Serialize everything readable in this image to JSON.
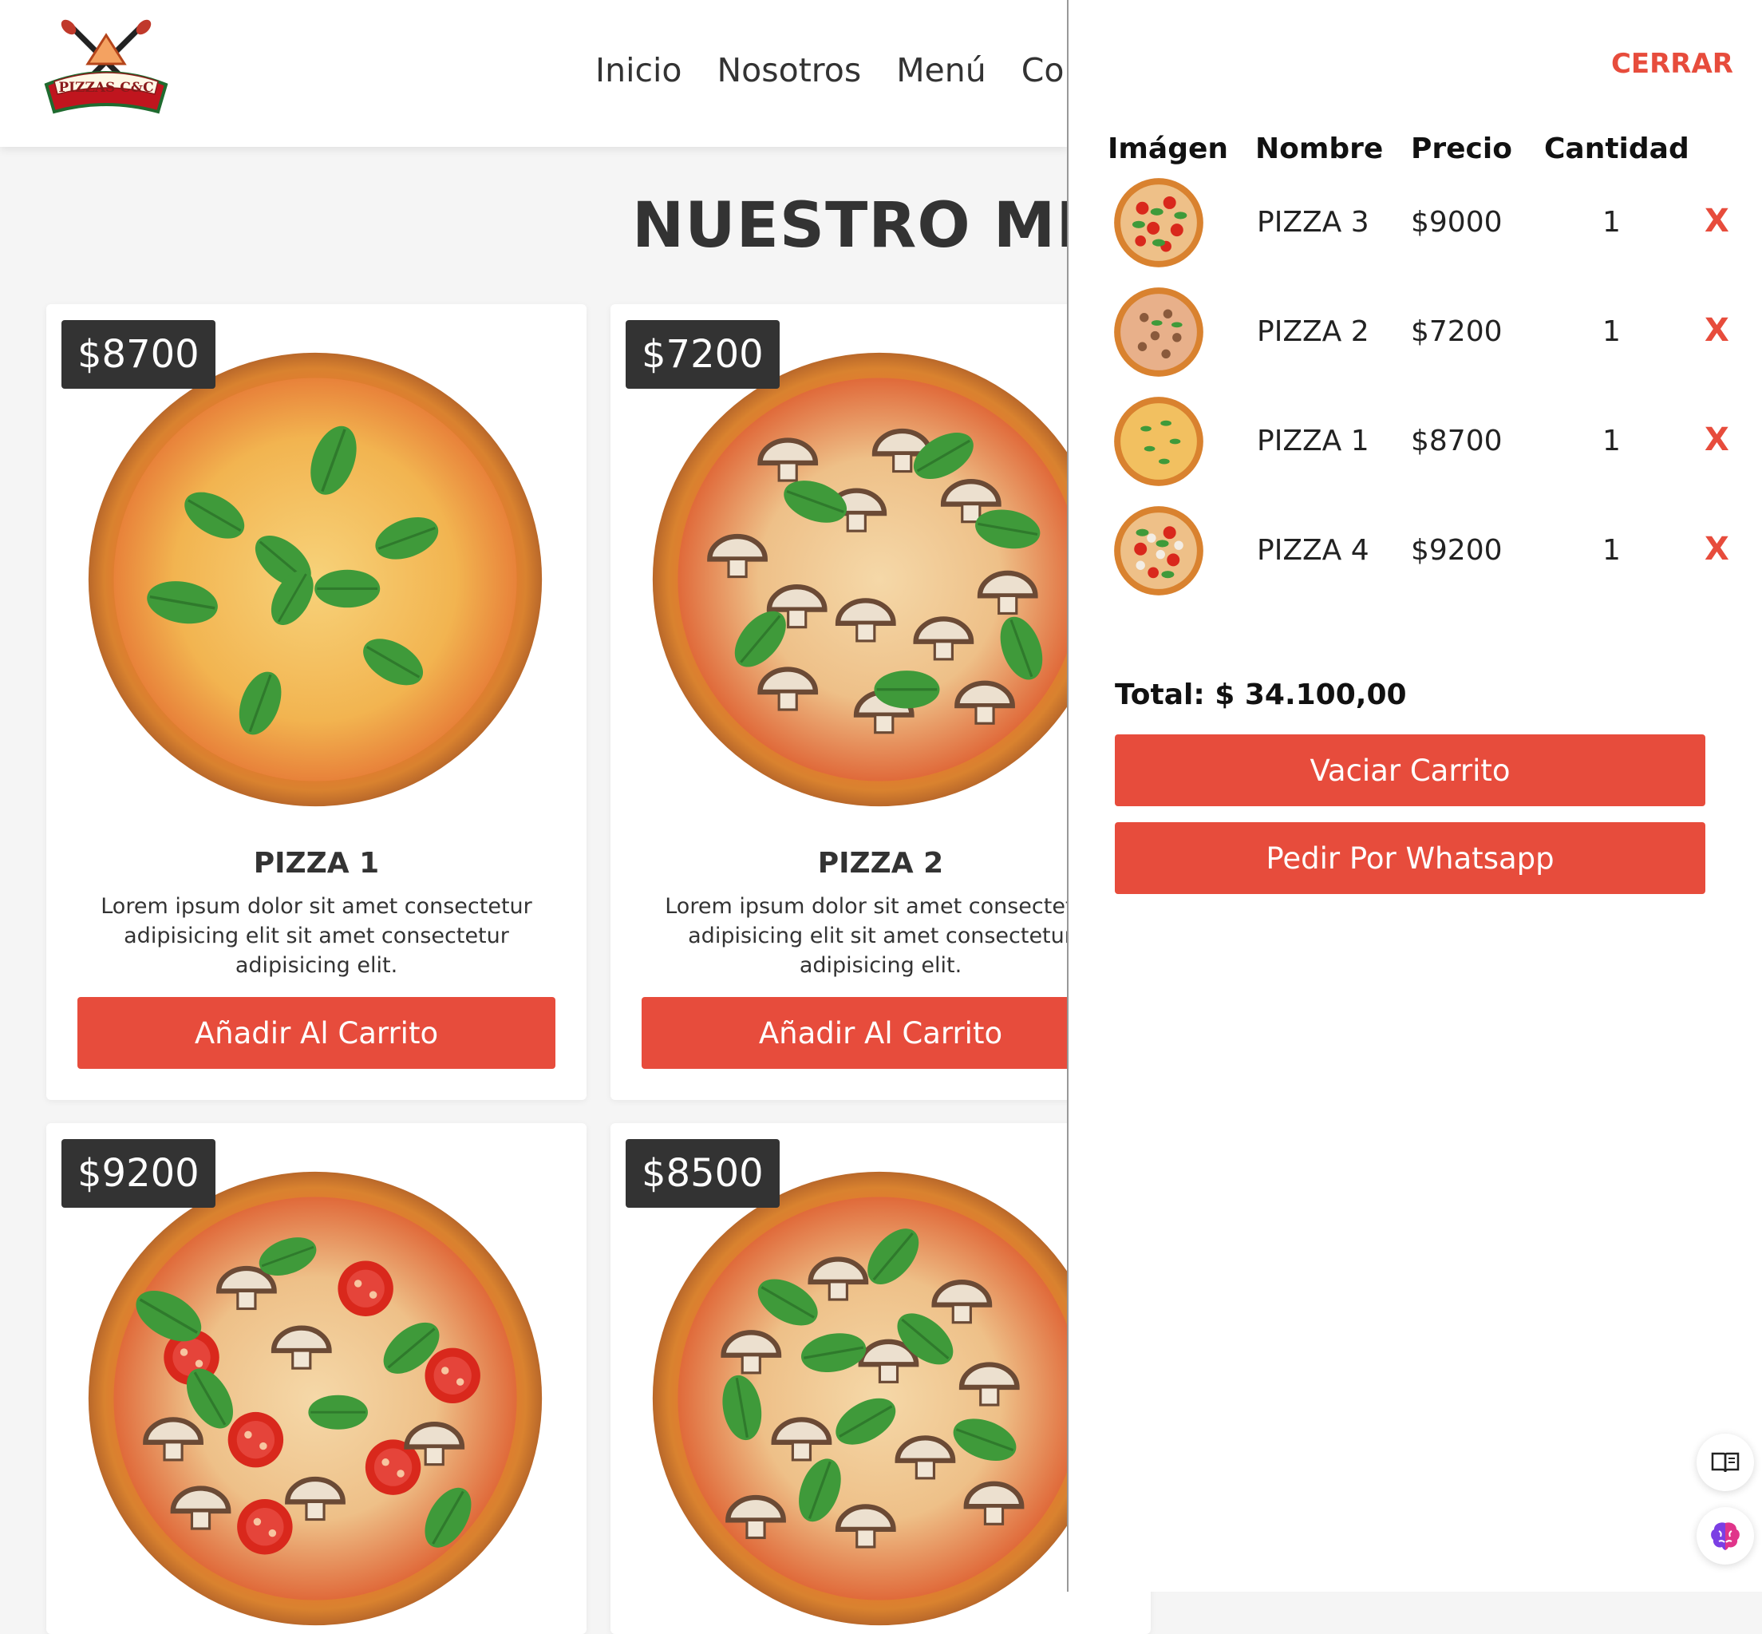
{
  "header": {
    "logo_text": "PIZZAS C&C",
    "nav": [
      {
        "label": "Inicio"
      },
      {
        "label": "Nosotros"
      },
      {
        "label": "Menú"
      },
      {
        "label": "Cont"
      }
    ]
  },
  "main": {
    "title": "NUESTRO MENÚ",
    "cards": [
      {
        "price": "$8700",
        "name": "PIZZA 1",
        "description": "Lorem ipsum dolor sit amet consectetur adipisicing elit sit amet consectetur adipisicing elit.",
        "button_label": "Añadir Al Carrito",
        "topping": "cheese-basil"
      },
      {
        "price": "$7200",
        "name": "PIZZA 2",
        "description": "Lorem ipsum dolor sit amet consectetur adipisicing elit sit amet consectetur adipisicing elit.",
        "button_label": "Añadir Al Carrito",
        "topping": "mushroom-basil"
      },
      {
        "price": "$9200",
        "name": "",
        "description": "",
        "button_label": "",
        "topping": "tomato-mushroom-basil"
      },
      {
        "price": "$8500",
        "name": "",
        "description": "",
        "button_label": "",
        "topping": "mushroom-basil-cheese"
      }
    ]
  },
  "cart": {
    "close_label": "CERRAR",
    "columns": [
      "Imágen",
      "Nombre",
      "Precio",
      "Cantidad"
    ],
    "items": [
      {
        "name": "PIZZA 3",
        "price": "$9000",
        "quantity": "1",
        "remove_label": "X"
      },
      {
        "name": "PIZZA 2",
        "price": "$7200",
        "quantity": "1",
        "remove_label": "X"
      },
      {
        "name": "PIZZA 1",
        "price": "$8700",
        "quantity": "1",
        "remove_label": "X"
      },
      {
        "name": "PIZZA 4",
        "price": "$9200",
        "quantity": "1",
        "remove_label": "X"
      }
    ],
    "total": "Total: $ 34.100,00",
    "empty_button": "Vaciar Carrito",
    "whatsapp_button": "Pedir Por Whatsapp"
  },
  "widgets": [
    {
      "icon": "book-reader-icon"
    },
    {
      "icon": "brain-icon"
    }
  ],
  "colors": {
    "accent": "#e74c3c",
    "dark": "#333333",
    "page_bg": "#f5f5f5"
  }
}
